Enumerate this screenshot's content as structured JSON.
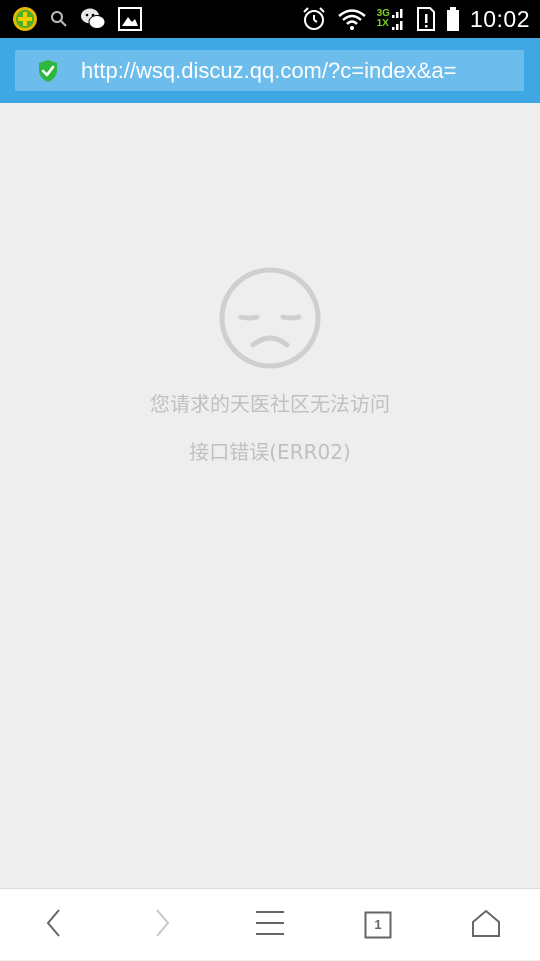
{
  "status_bar": {
    "time": "10:02",
    "network_top": "3G",
    "network_bottom": "1X",
    "icons_left": [
      "360-security-icon",
      "search-icon",
      "wechat-icon",
      "image-icon"
    ],
    "icons_right": [
      "alarm-icon",
      "wifi-icon",
      "signal-icon",
      "sim-alert-icon",
      "battery-icon"
    ]
  },
  "address_bar": {
    "url": "http://wsq.discuz.qq.com/?c=index&a=",
    "secure_icon": "shield-check-icon"
  },
  "error": {
    "icon": "sad-face-icon",
    "message": "您请求的天医社区无法访问",
    "code": "接口错误(ERR02)"
  },
  "toolbar": {
    "tab_count": "1",
    "buttons": [
      "back-icon",
      "forward-icon",
      "menu-icon",
      "tabs-icon",
      "home-icon"
    ]
  },
  "colors": {
    "address_bar": "#3fa7e4",
    "url_box": "#6cbcec",
    "content_bg": "#eeeeee",
    "error_text": "#c0c0c0",
    "secure_green": "#2db83d"
  }
}
